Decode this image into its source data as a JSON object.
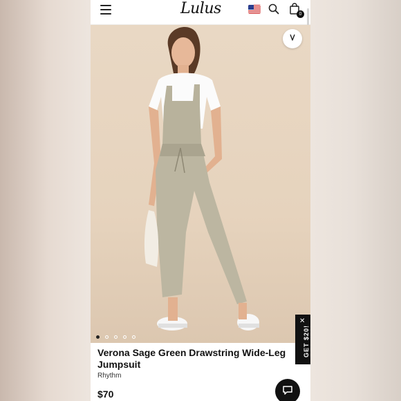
{
  "header": {
    "logo_text": "Lulus",
    "menu_icon": "hamburger-menu-icon",
    "flag_icon": "us-flag-icon",
    "search_icon": "search-icon",
    "bag_icon": "shopping-bag-icon",
    "bag_count": "0"
  },
  "gallery": {
    "wishlist_icon": "heart-icon",
    "image_count": 5,
    "active_index": 0
  },
  "promo": {
    "label": "GET $20!",
    "close_glyph": "✕"
  },
  "product": {
    "name": "Verona Sage Green Drawstring Wide-Leg Jumpsuit",
    "brand": "Rhythm",
    "price": "$70"
  },
  "chat": {
    "icon": "chat-bubble-icon"
  },
  "colors": {
    "accent": "#111111",
    "background": "#ffffff"
  }
}
